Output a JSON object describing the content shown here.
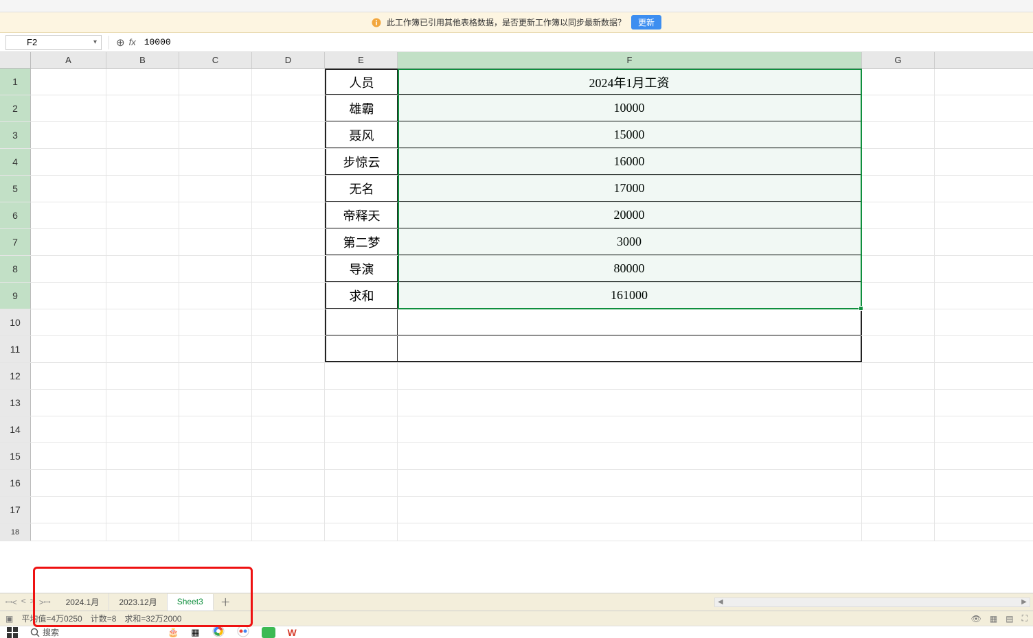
{
  "notification": {
    "message": "此工作簿已引用其他表格数据，是否更新工作簿以同步最新数据？",
    "button": "更新"
  },
  "namebox": {
    "ref": "F2"
  },
  "formula_bar": {
    "value": "10000"
  },
  "columns": [
    "A",
    "B",
    "C",
    "D",
    "E",
    "F",
    "G"
  ],
  "rows_shown": 18,
  "selected_col": "F",
  "selection": {
    "range": "F1:F9",
    "active": "F2"
  },
  "chart_data": {
    "type": "table",
    "title": "2024年1月工资",
    "columns": [
      "人员",
      "2024年1月工资"
    ],
    "rows": [
      [
        "雄霸",
        10000
      ],
      [
        "聂风",
        15000
      ],
      [
        "步惊云",
        16000
      ],
      [
        "无名",
        17000
      ],
      [
        "帝释天",
        20000
      ],
      [
        "第二梦",
        3000
      ],
      [
        "导演",
        80000
      ],
      [
        "求和",
        161000
      ]
    ]
  },
  "table": {
    "header_E": "人员",
    "header_F": "2024年1月工资",
    "rows": [
      {
        "e": "雄霸",
        "f": "10000"
      },
      {
        "e": "聂风",
        "f": "15000"
      },
      {
        "e": "步惊云",
        "f": "16000"
      },
      {
        "e": "无名",
        "f": "17000"
      },
      {
        "e": "帝释天",
        "f": "20000"
      },
      {
        "e": "第二梦",
        "f": "3000"
      },
      {
        "e": "导演",
        "f": "80000"
      },
      {
        "e": "求和",
        "f": "161000"
      }
    ]
  },
  "sheet_tabs": {
    "tabs": [
      {
        "name": "2024.1月",
        "active": false
      },
      {
        "name": "2023.12月",
        "active": false
      },
      {
        "name": "Sheet3",
        "active": true
      }
    ]
  },
  "status": {
    "avg_label": "平均值=4万0250",
    "count_label": "计数=8",
    "sum_label": "求和=32万2000"
  },
  "os": {
    "search_placeholder": "搜索"
  }
}
